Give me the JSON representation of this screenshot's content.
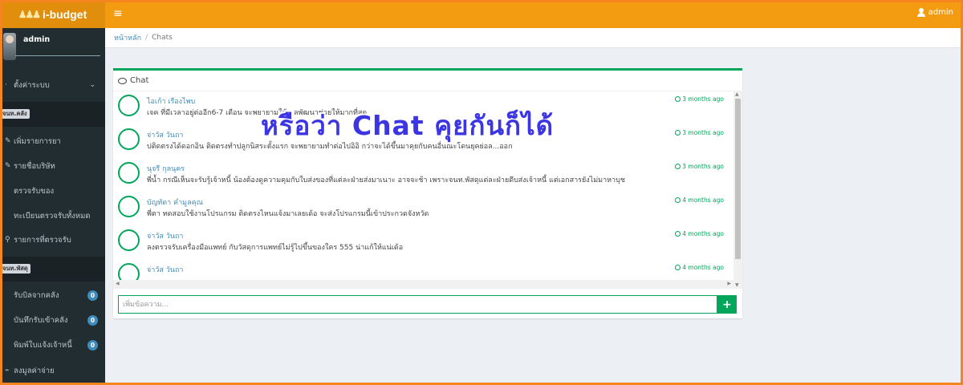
{
  "app": {
    "logo_text": "i-budget",
    "menu_icon": "hamburger-icon"
  },
  "header": {
    "user_label": "admin"
  },
  "sidebar": {
    "user_name": "admin",
    "items": [
      {
        "label": "ตั้งค่าระบบ",
        "icon": "settings-icon"
      },
      {
        "label": "เพิ่มรายการยา",
        "icon": "pencil-icon"
      },
      {
        "label": "รายชื่อบริษัท",
        "icon": "pencil-icon"
      },
      {
        "label": "ตรวจรับของ",
        "icon": "check-icon"
      },
      {
        "label": "ทะเบียนตรวจรับทั้งหมด",
        "icon": "list-icon"
      },
      {
        "label": "รายการที่ตรวจรับ",
        "icon": "search-icon"
      },
      {
        "label": "รับบิลจากคลัง",
        "badge": "0"
      },
      {
        "label": "บันทึกรับเข้าคลัง",
        "badge": "0"
      },
      {
        "label": "พิมพ์ใบแจ้งเจ้าหนี้",
        "badge": "0"
      },
      {
        "label": "ลงมูลค่าจ่าย",
        "icon": "tag-icon"
      }
    ],
    "headers": [
      "จนท.คลัง",
      "จนท.พัสดุ"
    ]
  },
  "breadcrumb": {
    "home": "หน้าหลัก",
    "current": "Chats"
  },
  "chat": {
    "title": "Chat",
    "messages": [
      {
        "name": "ไอเก้า เรืองไพบ",
        "text": "เจค ที่มีเวลาอยู่ต่ออีก6-7 เดือน จะพยายามให้...ลพัฒนาช่วยให้มากที่สุด",
        "time": "3 months ago"
      },
      {
        "name": "จ่าวัส วันถา",
        "text": "ปติดตรงได้ดอกอิน ติดตรงทำปลูกนิสระตั้งแรก จะพยายามทำต่อไปอิอิ กว่าจะได้ขึ้นมาคุยกับคนอื่นณะโดนยุคย่อล...ออก",
        "time": "3 months ago"
      },
      {
        "name": "นุจรี กุลนุคร",
        "text": "พี่น้ำ กรณีเห็นจะรับรู้เจ้าหนี้ น้องต้องดูความคุมกับใบส่งของที่แต่ละฝ่ายส่งมาเนาะ อาจจะช้า เพราะจนท.พัสดุแต่ละฝ่ายดีบส่งเจ้าหนี้ แต่เอกสารยังไม่มาหาบุช",
        "time": "3 months ago"
      },
      {
        "name": "บัญทัดา คำมูลคุณ",
        "text": "พี่ตา ทดสอบใช้งานโปรแกรม ติดตรงไหนแจ้งมาเลยเด้อ จะส่งโปรแกรมนี้เข้าประกวดจังหวัด",
        "time": "4 months ago"
      },
      {
        "name": "จ่าวัส วันถา",
        "text": "ลงตรวจรับเครื่องมือแพทย์ กับวัสดุการแพทย์ไม่รู้ไปขึ้นของใคร 555 น่าแก้ให้แน่เด้อ",
        "time": "4 months ago"
      },
      {
        "name": "จ่าวัส วันถา",
        "text": "",
        "time": "4 months ago"
      }
    ],
    "input_placeholder": "เพิ่มข้อความ...",
    "send_label": "+"
  },
  "overlay": {
    "text": "หรือว่า Chat คุยกันก็ได้"
  },
  "colors": {
    "topbar": "#f39c12",
    "sidebar": "#222d32",
    "accent": "#00a65a",
    "link": "#3c8dbc",
    "overlay": "#3b35e4"
  }
}
